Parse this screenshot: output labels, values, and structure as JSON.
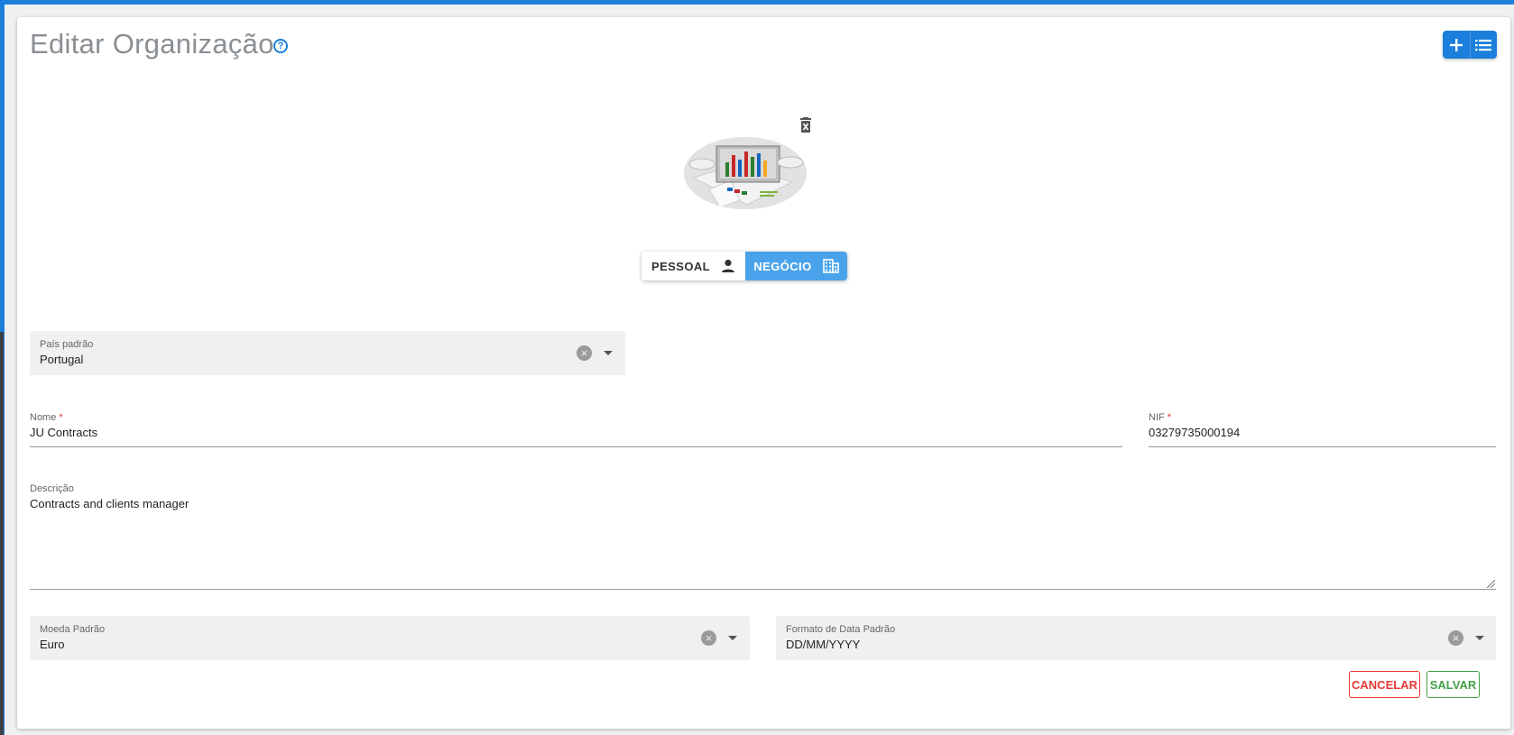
{
  "page": {
    "title": "Editar Organização",
    "accent_color": "#1b7fdb"
  },
  "top_actions": {
    "add_icon": "plus-icon",
    "list_icon": "list-icon"
  },
  "logo": {
    "image": "organization-logo-chart-image",
    "delete_icon": "delete-image-icon"
  },
  "type_toggle": {
    "personal_label": "PESSOAL",
    "personal_icon": "person-icon",
    "business_label": "NEGÓCIO",
    "business_icon": "business-icon",
    "selected": "NEGÓCIO"
  },
  "fields": {
    "country": {
      "label": "País padrão",
      "value": "Portugal"
    },
    "name": {
      "label": "Nome",
      "required_mark": "*",
      "value": "JU Contracts"
    },
    "nif": {
      "label": "NIF",
      "required_mark": "*",
      "value": "03279735000194"
    },
    "description": {
      "label": "Descrição",
      "value": "Contracts and clients manager"
    },
    "currency": {
      "label": "Moeda Padrão",
      "value": "Euro"
    },
    "date_format": {
      "label": "Formato de Data Padrão",
      "value": "DD/MM/YYYY"
    }
  },
  "buttons": {
    "cancel": "CANCELAR",
    "save": "SALVAR"
  }
}
